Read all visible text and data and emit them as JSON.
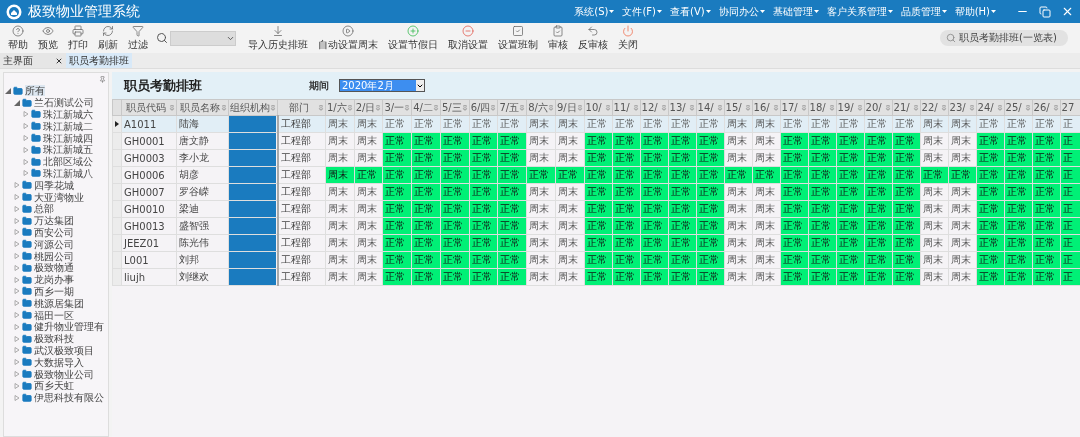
{
  "window": {
    "title": "极致物业管理系统"
  },
  "menu": [
    {
      "label": "系统(S)"
    },
    {
      "label": "文件(F)"
    },
    {
      "label": "查看(V)"
    },
    {
      "label": "协同办公"
    },
    {
      "label": "基础管理"
    },
    {
      "label": "客户关系管理"
    },
    {
      "label": "品质管理"
    },
    {
      "label": "帮助(H)"
    }
  ],
  "toolbar": [
    {
      "kind": "button",
      "label": "帮助"
    },
    {
      "kind": "button",
      "label": "预览"
    },
    {
      "kind": "button",
      "label": "打印"
    },
    {
      "kind": "button",
      "label": "刷新"
    },
    {
      "kind": "button",
      "label": "过滤"
    },
    {
      "kind": "search"
    },
    {
      "kind": "button",
      "label": "导入历史排班"
    },
    {
      "kind": "button",
      "label": "自动设置周末"
    },
    {
      "kind": "button",
      "label": "设置节假日"
    },
    {
      "kind": "button",
      "label": "取消设置"
    },
    {
      "kind": "button",
      "label": "设置班制"
    },
    {
      "kind": "button",
      "label": "审核"
    },
    {
      "kind": "button",
      "label": "反审核"
    },
    {
      "kind": "button",
      "label": "关闭"
    }
  ],
  "global_search": {
    "placeholder": "职员考勤排班(一览表)"
  },
  "tabs": [
    {
      "label": "主界面",
      "selected": false
    },
    {
      "label": "职员考勤排班",
      "selected": true
    }
  ],
  "sidebar": {
    "tree": [
      {
        "label": "所有",
        "selected": true,
        "expanded": true,
        "children": [
          {
            "label": "兰石测试公司",
            "selected": false,
            "expanded": true,
            "children": [
              {
                "label": "珠江新城六",
                "selected": false,
                "expanded": false
              },
              {
                "label": "珠江新城二",
                "selected": false,
                "expanded": false
              },
              {
                "label": "珠江新城四",
                "selected": false,
                "expanded": false
              },
              {
                "label": "珠江新城五",
                "selected": false,
                "expanded": false
              },
              {
                "label": "北部区域公",
                "selected": false,
                "expanded": false
              },
              {
                "label": "珠江新城八",
                "selected": false,
                "expanded": false
              }
            ]
          },
          {
            "label": "四季花城",
            "selected": false,
            "expanded": false
          },
          {
            "label": "大亚湾物业",
            "selected": false,
            "expanded": false
          },
          {
            "label": "总部",
            "selected": false,
            "expanded": false
          },
          {
            "label": "万达集团",
            "selected": false,
            "expanded": false
          },
          {
            "label": "西安公司",
            "selected": false,
            "expanded": false
          },
          {
            "label": "河源公司",
            "selected": false,
            "expanded": false
          },
          {
            "label": "桃园公司",
            "selected": false,
            "expanded": false
          },
          {
            "label": "极致物通",
            "selected": false,
            "expanded": false
          },
          {
            "label": "龙岗办事",
            "selected": false,
            "expanded": false
          },
          {
            "label": "西乡一期",
            "selected": false,
            "expanded": false
          },
          {
            "label": "桃源居集团",
            "selected": false,
            "expanded": false
          },
          {
            "label": "福田一区",
            "selected": false,
            "expanded": false
          },
          {
            "label": "健升物业管理有",
            "selected": false,
            "expanded": false
          },
          {
            "label": "极致科技",
            "selected": false,
            "expanded": false
          },
          {
            "label": "武汉极致项目",
            "selected": false,
            "expanded": false
          },
          {
            "label": "大数据导入",
            "selected": false,
            "expanded": false
          },
          {
            "label": "极致物业公司",
            "selected": false,
            "expanded": false
          },
          {
            "label": "西乡天虹",
            "selected": false,
            "expanded": false
          },
          {
            "label": "伊思科技有限公",
            "selected": false,
            "expanded": false
          }
        ]
      }
    ]
  },
  "form": {
    "title": "职员考勤排班",
    "period_label": "期间",
    "period": {
      "value": "2020年2月"
    }
  },
  "table": {
    "columns": [
      "职员代码",
      "职员名称",
      "组织机构",
      "部门",
      "1/六",
      "2/日",
      "3/一",
      "4/二",
      "5/三",
      "6/四",
      "7/五",
      "8/六",
      "9/日",
      "10/",
      "11/",
      "12/",
      "13/",
      "14/",
      "15/",
      "16/",
      "17/",
      "18/",
      "19/",
      "20/",
      "21/",
      "22/",
      "23/",
      "24/",
      "25/",
      "26/",
      "27"
    ],
    "rows": [
      {
        "selected": true,
        "code": "A1011",
        "name": "陆海",
        "dept": "工程部",
        "days": [
          {
            "text": "周末",
            "highlighted": false
          },
          {
            "text": "周末",
            "highlighted": false
          },
          {
            "text": "正常",
            "highlighted": false
          },
          {
            "text": "正常",
            "highlighted": false
          },
          {
            "text": "正常",
            "highlighted": false
          },
          {
            "text": "正常",
            "highlighted": false
          },
          {
            "text": "正常",
            "highlighted": false
          },
          {
            "text": "周末",
            "highlighted": false
          },
          {
            "text": "周末",
            "highlighted": false
          },
          {
            "text": "正常",
            "highlighted": false
          },
          {
            "text": "正常",
            "highlighted": false
          },
          {
            "text": "正常",
            "highlighted": false
          },
          {
            "text": "正常",
            "highlighted": false
          },
          {
            "text": "正常",
            "highlighted": false
          },
          {
            "text": "周末",
            "highlighted": false
          },
          {
            "text": "周末",
            "highlighted": false
          },
          {
            "text": "正常",
            "highlighted": false
          },
          {
            "text": "正常",
            "highlighted": false
          },
          {
            "text": "正常",
            "highlighted": false
          },
          {
            "text": "正常",
            "highlighted": false
          },
          {
            "text": "正常",
            "highlighted": false
          },
          {
            "text": "周末",
            "highlighted": false
          },
          {
            "text": "周末",
            "highlighted": false
          },
          {
            "text": "正常",
            "highlighted": false
          },
          {
            "text": "正常",
            "highlighted": false
          },
          {
            "text": "正常",
            "highlighted": false
          },
          {
            "text": "正",
            "highlighted": false
          }
        ]
      },
      {
        "selected": false,
        "code": "GH0001",
        "name": "唐文静",
        "dept": "工程部",
        "days": [
          {
            "text": "周末",
            "highlighted": false
          },
          {
            "text": "周末",
            "highlighted": false
          },
          {
            "text": "正常",
            "highlighted": true
          },
          {
            "text": "正常",
            "highlighted": true
          },
          {
            "text": "正常",
            "highlighted": true
          },
          {
            "text": "正常",
            "highlighted": true
          },
          {
            "text": "正常",
            "highlighted": true
          },
          {
            "text": "周末",
            "highlighted": false
          },
          {
            "text": "周末",
            "highlighted": false
          },
          {
            "text": "正常",
            "highlighted": true
          },
          {
            "text": "正常",
            "highlighted": true
          },
          {
            "text": "正常",
            "highlighted": true
          },
          {
            "text": "正常",
            "highlighted": true
          },
          {
            "text": "正常",
            "highlighted": true
          },
          {
            "text": "周末",
            "highlighted": false
          },
          {
            "text": "周末",
            "highlighted": false
          },
          {
            "text": "正常",
            "highlighted": true
          },
          {
            "text": "正常",
            "highlighted": true
          },
          {
            "text": "正常",
            "highlighted": true
          },
          {
            "text": "正常",
            "highlighted": true
          },
          {
            "text": "正常",
            "highlighted": true
          },
          {
            "text": "周末",
            "highlighted": false
          },
          {
            "text": "周末",
            "highlighted": false
          },
          {
            "text": "正常",
            "highlighted": true
          },
          {
            "text": "正常",
            "highlighted": true
          },
          {
            "text": "正常",
            "highlighted": true
          },
          {
            "text": "正",
            "highlighted": true
          }
        ]
      },
      {
        "selected": false,
        "code": "GH0003",
        "name": "李小龙",
        "dept": "工程部",
        "days": [
          {
            "text": "周末",
            "highlighted": false
          },
          {
            "text": "周末",
            "highlighted": false
          },
          {
            "text": "正常",
            "highlighted": true
          },
          {
            "text": "正常",
            "highlighted": true
          },
          {
            "text": "正常",
            "highlighted": true
          },
          {
            "text": "正常",
            "highlighted": true
          },
          {
            "text": "正常",
            "highlighted": true
          },
          {
            "text": "周末",
            "highlighted": false
          },
          {
            "text": "周末",
            "highlighted": false
          },
          {
            "text": "正常",
            "highlighted": true
          },
          {
            "text": "正常",
            "highlighted": true
          },
          {
            "text": "正常",
            "highlighted": true
          },
          {
            "text": "正常",
            "highlighted": true
          },
          {
            "text": "正常",
            "highlighted": true
          },
          {
            "text": "周末",
            "highlighted": false
          },
          {
            "text": "周末",
            "highlighted": false
          },
          {
            "text": "正常",
            "highlighted": true
          },
          {
            "text": "正常",
            "highlighted": true
          },
          {
            "text": "正常",
            "highlighted": true
          },
          {
            "text": "正常",
            "highlighted": true
          },
          {
            "text": "正常",
            "highlighted": true
          },
          {
            "text": "周末",
            "highlighted": false
          },
          {
            "text": "周末",
            "highlighted": false
          },
          {
            "text": "正常",
            "highlighted": true
          },
          {
            "text": "正常",
            "highlighted": true
          },
          {
            "text": "正常",
            "highlighted": true
          },
          {
            "text": "正",
            "highlighted": true
          }
        ]
      },
      {
        "selected": false,
        "code": "GH0006",
        "name": "胡彦",
        "dept": "工程部",
        "days": [
          {
            "text": "周末",
            "highlighted": true
          },
          {
            "text": "正常",
            "highlighted": true
          },
          {
            "text": "正常",
            "highlighted": true
          },
          {
            "text": "正常",
            "highlighted": true
          },
          {
            "text": "正常",
            "highlighted": true
          },
          {
            "text": "正常",
            "highlighted": true
          },
          {
            "text": "正常",
            "highlighted": true
          },
          {
            "text": "正常",
            "highlighted": true
          },
          {
            "text": "正常",
            "highlighted": true
          },
          {
            "text": "正常",
            "highlighted": true
          },
          {
            "text": "正常",
            "highlighted": true
          },
          {
            "text": "正常",
            "highlighted": true
          },
          {
            "text": "正常",
            "highlighted": true
          },
          {
            "text": "正常",
            "highlighted": true
          },
          {
            "text": "正常",
            "highlighted": true
          },
          {
            "text": "正常",
            "highlighted": true
          },
          {
            "text": "正常",
            "highlighted": true
          },
          {
            "text": "正常",
            "highlighted": true
          },
          {
            "text": "正常",
            "highlighted": true
          },
          {
            "text": "正常",
            "highlighted": true
          },
          {
            "text": "正常",
            "highlighted": true
          },
          {
            "text": "正常",
            "highlighted": true
          },
          {
            "text": "正常",
            "highlighted": true
          },
          {
            "text": "正常",
            "highlighted": true
          },
          {
            "text": "正常",
            "highlighted": true
          },
          {
            "text": "正常",
            "highlighted": true
          },
          {
            "text": "正",
            "highlighted": true
          }
        ]
      },
      {
        "selected": false,
        "code": "GH0007",
        "name": "罗谷嵘",
        "dept": "工程部",
        "days": [
          {
            "text": "周末",
            "highlighted": false
          },
          {
            "text": "周末",
            "highlighted": false
          },
          {
            "text": "正常",
            "highlighted": true
          },
          {
            "text": "正常",
            "highlighted": true
          },
          {
            "text": "正常",
            "highlighted": true
          },
          {
            "text": "正常",
            "highlighted": true
          },
          {
            "text": "正常",
            "highlighted": true
          },
          {
            "text": "周末",
            "highlighted": false
          },
          {
            "text": "周末",
            "highlighted": false
          },
          {
            "text": "正常",
            "highlighted": true
          },
          {
            "text": "正常",
            "highlighted": true
          },
          {
            "text": "正常",
            "highlighted": true
          },
          {
            "text": "正常",
            "highlighted": true
          },
          {
            "text": "正常",
            "highlighted": true
          },
          {
            "text": "周末",
            "highlighted": false
          },
          {
            "text": "周末",
            "highlighted": false
          },
          {
            "text": "正常",
            "highlighted": true
          },
          {
            "text": "正常",
            "highlighted": true
          },
          {
            "text": "正常",
            "highlighted": true
          },
          {
            "text": "正常",
            "highlighted": true
          },
          {
            "text": "正常",
            "highlighted": true
          },
          {
            "text": "周末",
            "highlighted": false
          },
          {
            "text": "周末",
            "highlighted": false
          },
          {
            "text": "正常",
            "highlighted": true
          },
          {
            "text": "正常",
            "highlighted": true
          },
          {
            "text": "正常",
            "highlighted": true
          },
          {
            "text": "正",
            "highlighted": true
          }
        ]
      },
      {
        "selected": false,
        "code": "GH0010",
        "name": "梁迪",
        "dept": "工程部",
        "days": [
          {
            "text": "周末",
            "highlighted": false
          },
          {
            "text": "周末",
            "highlighted": false
          },
          {
            "text": "正常",
            "highlighted": true
          },
          {
            "text": "正常",
            "highlighted": true
          },
          {
            "text": "正常",
            "highlighted": true
          },
          {
            "text": "正常",
            "highlighted": true
          },
          {
            "text": "正常",
            "highlighted": true
          },
          {
            "text": "周末",
            "highlighted": false
          },
          {
            "text": "周末",
            "highlighted": false
          },
          {
            "text": "正常",
            "highlighted": true
          },
          {
            "text": "正常",
            "highlighted": true
          },
          {
            "text": "正常",
            "highlighted": true
          },
          {
            "text": "正常",
            "highlighted": true
          },
          {
            "text": "正常",
            "highlighted": true
          },
          {
            "text": "周末",
            "highlighted": false
          },
          {
            "text": "周末",
            "highlighted": false
          },
          {
            "text": "正常",
            "highlighted": true
          },
          {
            "text": "正常",
            "highlighted": true
          },
          {
            "text": "正常",
            "highlighted": true
          },
          {
            "text": "正常",
            "highlighted": true
          },
          {
            "text": "正常",
            "highlighted": true
          },
          {
            "text": "周末",
            "highlighted": false
          },
          {
            "text": "周末",
            "highlighted": false
          },
          {
            "text": "正常",
            "highlighted": true
          },
          {
            "text": "正常",
            "highlighted": true
          },
          {
            "text": "正常",
            "highlighted": true
          },
          {
            "text": "正",
            "highlighted": true
          }
        ]
      },
      {
        "selected": false,
        "code": "GH0013",
        "name": "盛智强",
        "dept": "工程部",
        "days": [
          {
            "text": "周末",
            "highlighted": false
          },
          {
            "text": "周末",
            "highlighted": false
          },
          {
            "text": "正常",
            "highlighted": true
          },
          {
            "text": "正常",
            "highlighted": true
          },
          {
            "text": "正常",
            "highlighted": true
          },
          {
            "text": "正常",
            "highlighted": true
          },
          {
            "text": "正常",
            "highlighted": true
          },
          {
            "text": "周末",
            "highlighted": false
          },
          {
            "text": "周末",
            "highlighted": false
          },
          {
            "text": "正常",
            "highlighted": true
          },
          {
            "text": "正常",
            "highlighted": true
          },
          {
            "text": "正常",
            "highlighted": true
          },
          {
            "text": "正常",
            "highlighted": true
          },
          {
            "text": "正常",
            "highlighted": true
          },
          {
            "text": "周末",
            "highlighted": false
          },
          {
            "text": "周末",
            "highlighted": false
          },
          {
            "text": "正常",
            "highlighted": true
          },
          {
            "text": "正常",
            "highlighted": true
          },
          {
            "text": "正常",
            "highlighted": true
          },
          {
            "text": "正常",
            "highlighted": true
          },
          {
            "text": "正常",
            "highlighted": true
          },
          {
            "text": "周末",
            "highlighted": false
          },
          {
            "text": "周末",
            "highlighted": false
          },
          {
            "text": "正常",
            "highlighted": true
          },
          {
            "text": "正常",
            "highlighted": true
          },
          {
            "text": "正常",
            "highlighted": true
          },
          {
            "text": "正",
            "highlighted": true
          }
        ]
      },
      {
        "selected": false,
        "code": "JEEZ01",
        "name": "陈光伟",
        "dept": "工程部",
        "days": [
          {
            "text": "周末",
            "highlighted": false
          },
          {
            "text": "周末",
            "highlighted": false
          },
          {
            "text": "正常",
            "highlighted": true
          },
          {
            "text": "正常",
            "highlighted": true
          },
          {
            "text": "正常",
            "highlighted": true
          },
          {
            "text": "正常",
            "highlighted": true
          },
          {
            "text": "正常",
            "highlighted": true
          },
          {
            "text": "周末",
            "highlighted": false
          },
          {
            "text": "周末",
            "highlighted": false
          },
          {
            "text": "正常",
            "highlighted": true
          },
          {
            "text": "正常",
            "highlighted": true
          },
          {
            "text": "正常",
            "highlighted": true
          },
          {
            "text": "正常",
            "highlighted": true
          },
          {
            "text": "正常",
            "highlighted": true
          },
          {
            "text": "周末",
            "highlighted": false
          },
          {
            "text": "周末",
            "highlighted": false
          },
          {
            "text": "正常",
            "highlighted": true
          },
          {
            "text": "正常",
            "highlighted": true
          },
          {
            "text": "正常",
            "highlighted": true
          },
          {
            "text": "正常",
            "highlighted": true
          },
          {
            "text": "正常",
            "highlighted": true
          },
          {
            "text": "周末",
            "highlighted": false
          },
          {
            "text": "周末",
            "highlighted": false
          },
          {
            "text": "正常",
            "highlighted": true
          },
          {
            "text": "正常",
            "highlighted": true
          },
          {
            "text": "正常",
            "highlighted": true
          },
          {
            "text": "正",
            "highlighted": true
          }
        ]
      },
      {
        "selected": false,
        "code": "L001",
        "name": "刘邦",
        "dept": "工程部",
        "days": [
          {
            "text": "周末",
            "highlighted": false
          },
          {
            "text": "周末",
            "highlighted": false
          },
          {
            "text": "正常",
            "highlighted": true
          },
          {
            "text": "正常",
            "highlighted": true
          },
          {
            "text": "正常",
            "highlighted": true
          },
          {
            "text": "正常",
            "highlighted": true
          },
          {
            "text": "正常",
            "highlighted": true
          },
          {
            "text": "周末",
            "highlighted": false
          },
          {
            "text": "周末",
            "highlighted": false
          },
          {
            "text": "正常",
            "highlighted": true
          },
          {
            "text": "正常",
            "highlighted": true
          },
          {
            "text": "正常",
            "highlighted": true
          },
          {
            "text": "正常",
            "highlighted": true
          },
          {
            "text": "正常",
            "highlighted": true
          },
          {
            "text": "周末",
            "highlighted": false
          },
          {
            "text": "周末",
            "highlighted": false
          },
          {
            "text": "正常",
            "highlighted": true
          },
          {
            "text": "正常",
            "highlighted": true
          },
          {
            "text": "正常",
            "highlighted": true
          },
          {
            "text": "正常",
            "highlighted": true
          },
          {
            "text": "正常",
            "highlighted": true
          },
          {
            "text": "周末",
            "highlighted": false
          },
          {
            "text": "周末",
            "highlighted": false
          },
          {
            "text": "正常",
            "highlighted": true
          },
          {
            "text": "正常",
            "highlighted": true
          },
          {
            "text": "正常",
            "highlighted": true
          },
          {
            "text": "正",
            "highlighted": true
          }
        ]
      },
      {
        "selected": false,
        "code": "liujh",
        "name": "刘继欢",
        "dept": "工程部",
        "days": [
          {
            "text": "周末",
            "highlighted": false
          },
          {
            "text": "周末",
            "highlighted": false
          },
          {
            "text": "正常",
            "highlighted": true
          },
          {
            "text": "正常",
            "highlighted": true
          },
          {
            "text": "正常",
            "highlighted": true
          },
          {
            "text": "正常",
            "highlighted": true
          },
          {
            "text": "正常",
            "highlighted": true
          },
          {
            "text": "周末",
            "highlighted": false
          },
          {
            "text": "周末",
            "highlighted": false
          },
          {
            "text": "正常",
            "highlighted": true
          },
          {
            "text": "正常",
            "highlighted": true
          },
          {
            "text": "正常",
            "highlighted": true
          },
          {
            "text": "正常",
            "highlighted": true
          },
          {
            "text": "正常",
            "highlighted": true
          },
          {
            "text": "周末",
            "highlighted": false
          },
          {
            "text": "周末",
            "highlighted": false
          },
          {
            "text": "正常",
            "highlighted": true
          },
          {
            "text": "正常",
            "highlighted": true
          },
          {
            "text": "正常",
            "highlighted": true
          },
          {
            "text": "正常",
            "highlighted": true
          },
          {
            "text": "正常",
            "highlighted": true
          },
          {
            "text": "周末",
            "highlighted": false
          },
          {
            "text": "周末",
            "highlighted": false
          },
          {
            "text": "正常",
            "highlighted": true
          },
          {
            "text": "正常",
            "highlighted": true
          },
          {
            "text": "正常",
            "highlighted": true
          },
          {
            "text": "正",
            "highlighted": true
          }
        ]
      }
    ]
  }
}
